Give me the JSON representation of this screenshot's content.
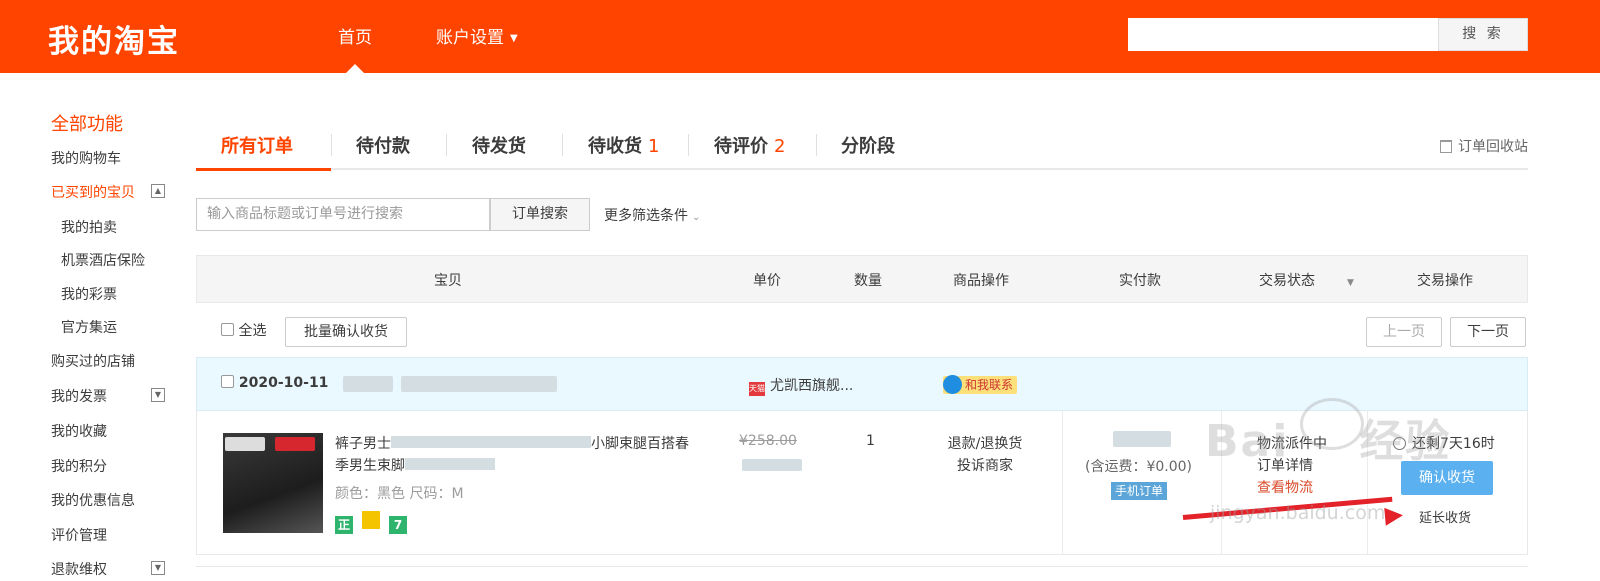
{
  "header": {
    "logo": "我的淘宝",
    "nav_home": "首页",
    "nav_account": "账户设置",
    "search_placeholder": "",
    "search_button": "搜 索"
  },
  "sidebar": {
    "title": "全部功能",
    "items": [
      "我的购物车",
      "已买到的宝贝",
      "我的拍卖",
      "机票酒店保险",
      "我的彩票",
      "官方集运",
      "购买过的店铺",
      "我的发票",
      "我的收藏",
      "我的积分",
      "我的优惠信息",
      "评价管理",
      "退款维权"
    ]
  },
  "tabs": {
    "all": "所有订单",
    "pending_pay": "待付款",
    "pending_ship": "待发货",
    "pending_receive": "待收货",
    "pending_receive_count": "1",
    "pending_review": "待评价",
    "pending_review_count": "2",
    "installment": "分阶段",
    "recycle": "订单回收站"
  },
  "filter": {
    "placeholder": "输入商品标题或订单号进行搜索",
    "search_button": "订单搜索",
    "more": "更多筛选条件"
  },
  "table_headers": [
    "宝贝",
    "单价",
    "数量",
    "商品操作",
    "实付款",
    "交易状态",
    "交易操作"
  ],
  "toolbar": {
    "select_all": "全选",
    "batch_confirm": "批量确认收货",
    "prev_page": "上一页",
    "next_page": "下一页"
  },
  "order": {
    "date": "2020-10-11",
    "shop": "尤凯西旗舰...",
    "tmall_badge": "天猫",
    "contact": "和我联系",
    "title_prefix": "裤子男士",
    "title_mid": "小脚束腿百搭春",
    "title_suffix": "季男生束脚",
    "attr": "颜色：黑色  尺码：M",
    "badges": [
      "正",
      "",
      "7"
    ],
    "original_price": "¥258.00",
    "quantity": "1",
    "op_refund": "退款/退换货",
    "op_complain": "投诉商家",
    "shipping": "(含运费：¥0.00)",
    "mobile_order": "手机订单",
    "status": "物流派件中",
    "status_detail": "订单详情",
    "status_logistics": "查看物流",
    "remaining": "还剩7天16时",
    "confirm": "确认收货",
    "delay": "延长收货"
  },
  "watermark": {
    "brand": "Bai",
    "brand2": "经验",
    "url": "jingyan.baidu.com"
  },
  "colors": {
    "brand": "#ff4400",
    "accent_blue": "#5bb0f0"
  }
}
